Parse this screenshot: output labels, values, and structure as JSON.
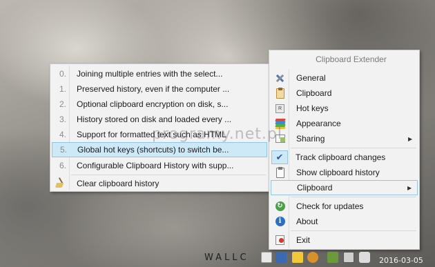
{
  "watermark": "programy.net.pl",
  "history_menu": {
    "items": [
      {
        "num": "0.",
        "text": "Joining multiple entries with the select..."
      },
      {
        "num": "1.",
        "text": "Preserved history, even if the computer ..."
      },
      {
        "num": "2.",
        "text": "Optional clipboard encryption on disk, s..."
      },
      {
        "num": "3.",
        "text": "History stored on disk and loaded every ..."
      },
      {
        "num": "4.",
        "text": "Support for formatted text such as HTML"
      },
      {
        "num": "5.",
        "text": "Global hot keys (shortcuts) to switch be..."
      },
      {
        "num": "6.",
        "text": "Configurable Clipboard History with supp..."
      }
    ],
    "clear_label": "Clear clipboard history",
    "highlighted_index": 5
  },
  "main_menu": {
    "title": "Clipboard Extender",
    "items": {
      "general": "General",
      "clipboard": "Clipboard",
      "hotkeys": "Hot keys",
      "appearance": "Appearance",
      "sharing": "Sharing",
      "track": "Track clipboard changes",
      "show_history": "Show clipboard history",
      "clipboard_sub": "Clipboard",
      "check_updates": "Check for updates",
      "about": "About",
      "exit": "Exit"
    },
    "icons": {
      "general": "tools-icon",
      "clipboard": "clipboard-icon",
      "hotkeys": "keyboard-key-icon",
      "appearance": "color-swatches-icon",
      "sharing": "share-icon",
      "track": "checkmark-icon",
      "show_history": "clipboard-outline-icon",
      "check_updates": "refresh-icon",
      "about": "info-icon",
      "exit": "exit-icon"
    }
  },
  "taskbar": {
    "brand": "WALLC",
    "clock": "2016-03-05"
  },
  "colors": {
    "highlight_bg": "#cde8f7",
    "highlight_border": "#8fc6e8",
    "menu_bg": "#f2f2f2"
  }
}
